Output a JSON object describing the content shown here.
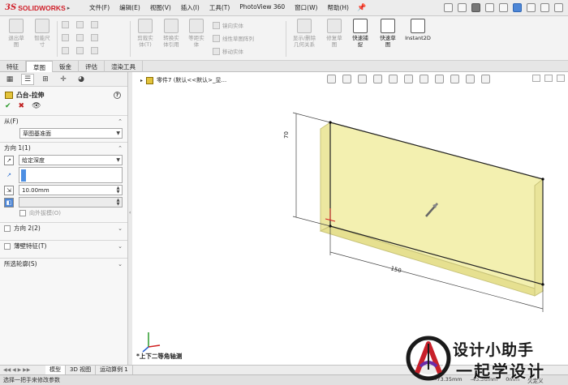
{
  "app": {
    "brand_prefix": "3S",
    "brand_name": "SOLIDWORKS"
  },
  "menu": [
    "文件(F)",
    "编辑(E)",
    "视图(V)",
    "插入(I)",
    "工具(T)",
    "PhotoView 360",
    "窗口(W)",
    "帮助(H)"
  ],
  "commands": {
    "exit_sketch": "退出草\n图",
    "smart_dim": "智能尺\n寸",
    "cut_entities": "剪裁实\n体(T)",
    "convert_entities": "转换实\n体引用",
    "offset_entities": "等距实\n体",
    "mirror": "镜向实体",
    "linear_pattern": "线性草图阵列",
    "move": "移动实体",
    "display_relations": "显示/删除\n几何关系",
    "repair_sketch": "修复草\n图",
    "quick_snap": "快速捕\n捉",
    "rapid_sketch": "快速草\n图",
    "instant2d": "Instant2D"
  },
  "tabs": [
    "特征",
    "草图",
    "钣金",
    "评估",
    "渲染工具"
  ],
  "active_tab": "草图",
  "pm": {
    "title": "凸台-拉伸",
    "from_label": "从(F)",
    "from_value": "草图基准面",
    "dir1_label": "方向 1(1)",
    "end_condition": "给定深度",
    "depth": "10.00mm",
    "draft_outward": "向外拔模(O)",
    "dir2_label": "方向 2(2)",
    "thin_feature_label": "薄壁特征(T)",
    "selected_contours_label": "所选轮廓(S)"
  },
  "graphics": {
    "tree_item": "零件7 (默认<<默认>_显...",
    "dim_horizontal": "150",
    "dim_vertical": "70",
    "view_label": "*上下二等角轴测"
  },
  "model_tabs": [
    "模型",
    "3D 视图",
    "运动算例 1"
  ],
  "status": {
    "message": "选择一把手来修改参数",
    "x": "-73.35mm",
    "y": "-43.36mm",
    "z": "0mm",
    "state": "欠定义"
  },
  "watermark": {
    "line1": "设计小助手",
    "line2": "一起学设计"
  },
  "colors": {
    "brand": "#d0202a",
    "extrude_fill": "#f3f0b0",
    "extrude_edge": "#b9b56a"
  }
}
